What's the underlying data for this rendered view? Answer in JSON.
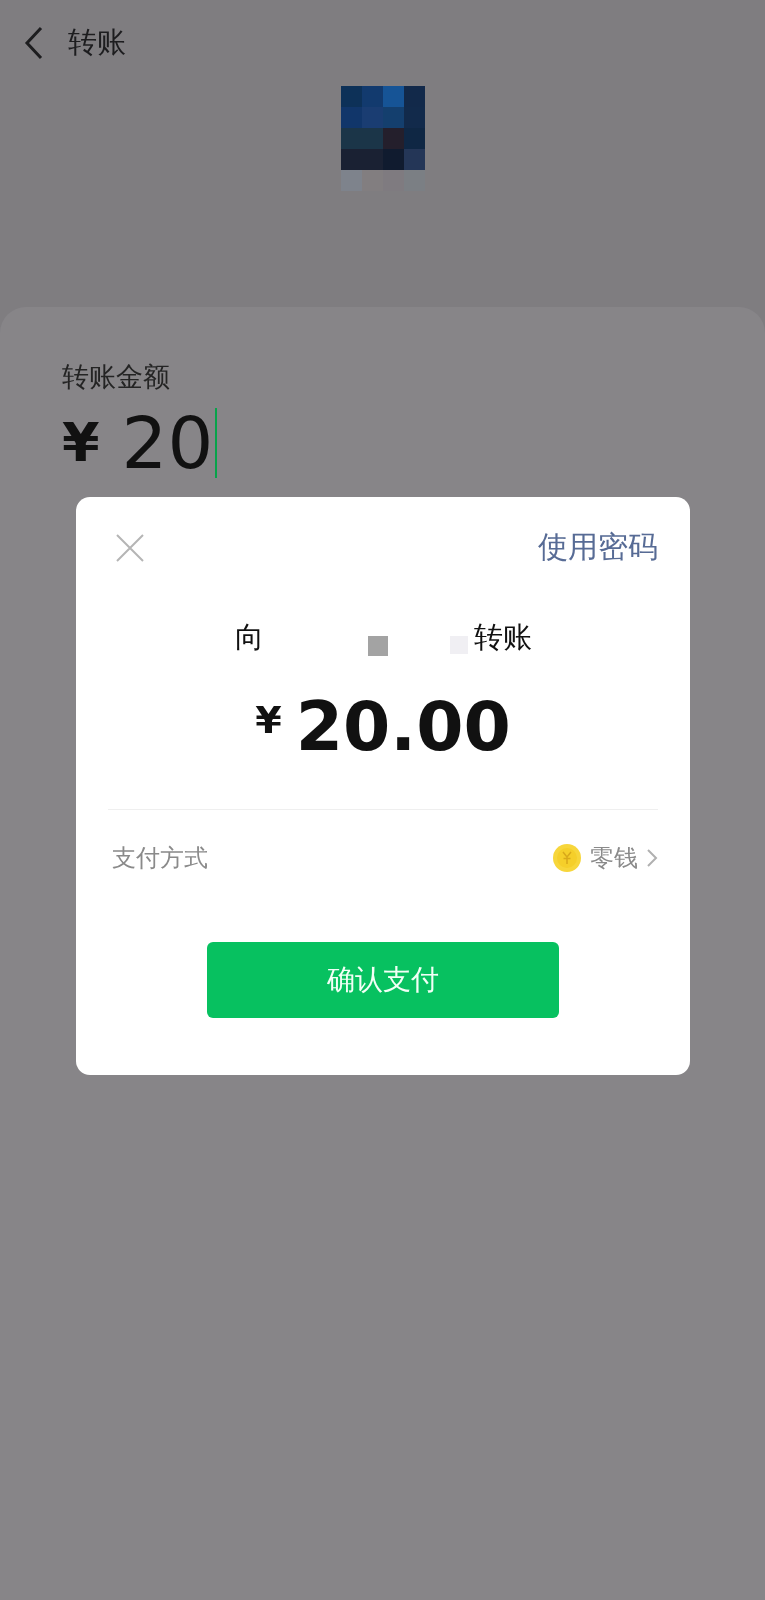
{
  "header": {
    "title": "转账"
  },
  "transfer_form": {
    "label": "转账金额",
    "currency": "¥",
    "value": "20"
  },
  "dialog": {
    "action": "使用密码",
    "payee_prefix": "向",
    "payee_suffix": "转账",
    "currency": "¥",
    "amount": "20.00",
    "payment_method": {
      "label": "支付方式",
      "value": "零钱"
    },
    "confirm_button": "确认支付"
  }
}
